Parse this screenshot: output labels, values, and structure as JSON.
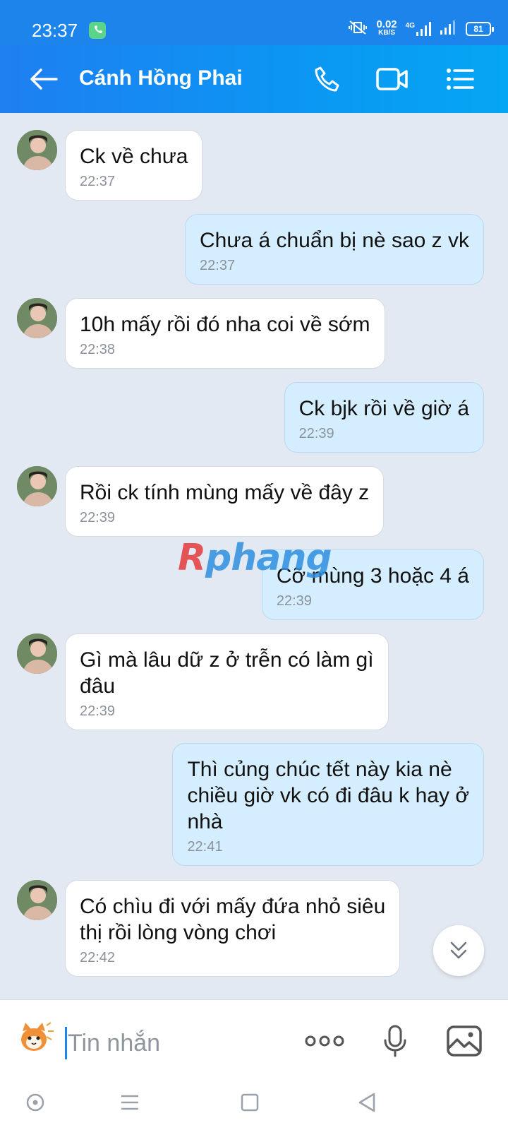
{
  "status_bar": {
    "time": "23:37",
    "net_speed": "0.02",
    "net_unit": "KB/S",
    "network": "4G",
    "battery": "81"
  },
  "header": {
    "contact_name": "Cánh Hồng Phai",
    "icons": [
      "back-arrow-icon",
      "phone-icon",
      "video-call-icon",
      "menu-list-icon"
    ],
    "gradient": [
      "#1e7ff1",
      "#05a6f3"
    ]
  },
  "messages": [
    {
      "direction": "in",
      "text": "Ck về chưa",
      "time": "22:37"
    },
    {
      "direction": "out",
      "text": "Chưa á chuẩn bị nè sao z vk",
      "time": "22:37"
    },
    {
      "direction": "in",
      "text": "10h mấy rồi đó nha coi về sớm",
      "time": "22:38"
    },
    {
      "direction": "out",
      "text": "Ck bjk rồi về giờ á",
      "time": "22:39"
    },
    {
      "direction": "in",
      "text": "Rồi ck tính mùng mấy về đây z",
      "time": "22:39"
    },
    {
      "direction": "out",
      "text": "Cỡ mùng 3 hoặc 4 á",
      "time": "22:39"
    },
    {
      "direction": "in",
      "text": "Gì mà lâu dữ z ở trễn có làm gì\nđâu",
      "time": "22:39"
    },
    {
      "direction": "out",
      "text": "Thì củng chúc tết này kia nè\nchiều giờ vk có đi đâu k hay ở\nnhà",
      "time": "22:41"
    },
    {
      "direction": "in",
      "text": "Có chìu đi với mấy đứa nhỏ siêu\nthị rồi lòng vòng chơi",
      "time": "22:42"
    }
  ],
  "watermark": {
    "first": "R",
    "rest": "phang"
  },
  "input_bar": {
    "placeholder": "Tin nhắn",
    "icons": [
      "sticker-icon",
      "more-options-icon",
      "microphone-icon",
      "image-icon"
    ]
  },
  "colors": {
    "accent": "#1d84ec",
    "incoming_bubble": "#ffffff",
    "outgoing_bubble": "#d5eeff",
    "chat_background": "#e3e9f2"
  }
}
